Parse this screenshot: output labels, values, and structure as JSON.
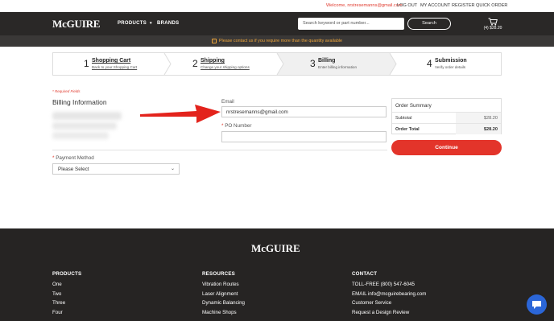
{
  "util": {
    "welcome": "Welcome, nrstresemanns@gmail.com",
    "logout": "LOG OUT",
    "account": "MY ACCOUNT",
    "register": "REGISTER",
    "quick_order": "QUICK ORDER"
  },
  "header": {
    "logo": "McGUIRE",
    "nav_products": "PRODUCTS",
    "nav_brands": "BRANDS",
    "search_placeholder": "Search keyword or part number...",
    "search_button": "Search",
    "cart_label": "(4) $28.20"
  },
  "notice": "Please contact us if you require more than the quantity available",
  "steps": [
    {
      "num": "1",
      "title": "Shopping Cart",
      "sub": "Back to your Shopping Cart"
    },
    {
      "num": "2",
      "title": "Shipping",
      "sub": "Change your shipping options"
    },
    {
      "num": "3",
      "title": "Billing",
      "sub": "Enter billing information"
    },
    {
      "num": "4",
      "title": "Submission",
      "sub": "Verify order details"
    }
  ],
  "form": {
    "required_note": "* Required Fields",
    "section_title": "Billing Information",
    "email_label": "Email",
    "email_value": "nrstresemanns@gmail.com",
    "po_label": "PO Number",
    "payment_label": "Payment Method",
    "payment_value": "Please Select"
  },
  "summary": {
    "title": "Order Summary",
    "subtotal_label": "Subtotal",
    "subtotal_value": "$28.20",
    "total_label": "Order Total",
    "total_value": "$28.20",
    "continue": "Continue"
  },
  "footer": {
    "logo": "McGUIRE",
    "columns": [
      {
        "heading": "PRODUCTS",
        "items": [
          "One",
          "Two",
          "Three",
          "Four"
        ]
      },
      {
        "heading": "RESOURCES",
        "items": [
          "Vibration Routes",
          "Laser Alignment",
          "Dynamic Balancing",
          "Machine Shops"
        ]
      },
      {
        "heading": "CONTACT",
        "items": [
          "TOLL-FREE (800) 547-6045",
          "EMAIL info@mcguirebearing.com",
          "Customer Service",
          "Request a Design Review"
        ]
      }
    ]
  },
  "colors": {
    "accent": "#e3342a",
    "header_bg": "#2a2827",
    "notice_text": "#f0a63a",
    "footer_bg": "#262423"
  },
  "icons": [
    "chevron-down-icon",
    "cart-icon",
    "info-icon",
    "arrow-annotation",
    "chat-icon"
  ]
}
